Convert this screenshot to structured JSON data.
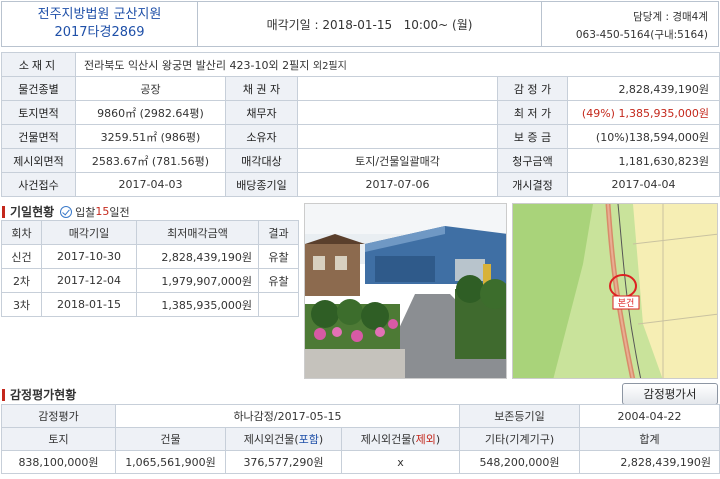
{
  "header": {
    "court": "전주지방법원 군산지원",
    "case_no": "2017타경2869",
    "sale_date": "매각기일 : 2018-01-15   10:00~ (월)",
    "dept": "담당계 : 경매4계",
    "phone": "063-450-5164(구내:5164)"
  },
  "info": {
    "address_label": "소재지",
    "address_value": "전라북도 익산시 왕궁면 발산리 423-10외 2필지",
    "address_note": "외2필지",
    "type_label": "물건종별",
    "type_value": "공장",
    "creditor_label": "채 권 자",
    "creditor_value": "",
    "appraisal_label": "감 정 가",
    "appraisal_value": "2,828,439,190원",
    "land_area_label": "토지면적",
    "land_area_value": "9860㎡ (2982.64평)",
    "debtor_label": "채무자",
    "debtor_value": "",
    "min_price_label": "최 저 가",
    "min_price_value": "(49%) 1,385,935,000원",
    "building_area_label": "건물면적",
    "building_area_value": "3259.51㎡ (986평)",
    "owner_label": "소유자",
    "owner_value": "",
    "deposit_label": "보 증 금",
    "deposit_value": "(10%)138,594,000원",
    "excluded_area_label": "제시외면적",
    "excluded_area_value": "2583.67㎡ (781.56평)",
    "sale_target_label": "매각대상",
    "sale_target_value": "토지/건물일괄매각",
    "claim_label": "청구금액",
    "claim_value": "1,181,630,823원",
    "filed_label": "사건접수",
    "filed_value": "2017-04-03",
    "dividend_label": "배당종기일",
    "dividend_value": "2017-07-06",
    "start_label": "개시결정",
    "start_value": "2017-04-04"
  },
  "rounds": {
    "section_title": "기일현황",
    "bid_note_prefix": "입찰",
    "bid_note_days": "15",
    "bid_note_suffix": "일전",
    "headers": [
      "회차",
      "매각기일",
      "최저매각금액",
      "결과"
    ],
    "rows": [
      {
        "round": "신건",
        "date": "2017-10-30",
        "price": "2,828,439,190원",
        "result": "유찰"
      },
      {
        "round": "2차",
        "date": "2017-12-04",
        "price": "1,979,907,000원",
        "result": "유찰"
      },
      {
        "round": "3차",
        "date": "2018-01-15",
        "price": "1,385,935,000원",
        "result": ""
      }
    ]
  },
  "map": {
    "marker_label": "본건"
  },
  "appraisal": {
    "section_title": "감정평가현황",
    "button_label": "감정평가서",
    "row1": {
      "label": "감정평가",
      "value": "하나감정/2017-05-15",
      "preserve_label": "보존등기일",
      "preserve_value": "2004-04-22"
    },
    "head": {
      "land": "토지",
      "building": "건물",
      "excl_incl_prefix": "제시외건물(",
      "excl_incl_word": "포함",
      "excl_excl_prefix": "제시외건물(",
      "excl_excl_word": "제외",
      "other": "기타(기계기구)",
      "total": "합계"
    },
    "values": {
      "land": "838,100,000원",
      "building": "1,065,561,900원",
      "excl_incl": "376,577,290원",
      "excl_excl": "x",
      "other": "548,200,000원",
      "total": "2,828,439,190원"
    }
  },
  "colors": {
    "accent_blue": "#1f50a8",
    "accent_red": "#c4281c",
    "label_bg": "#eef1f6"
  }
}
